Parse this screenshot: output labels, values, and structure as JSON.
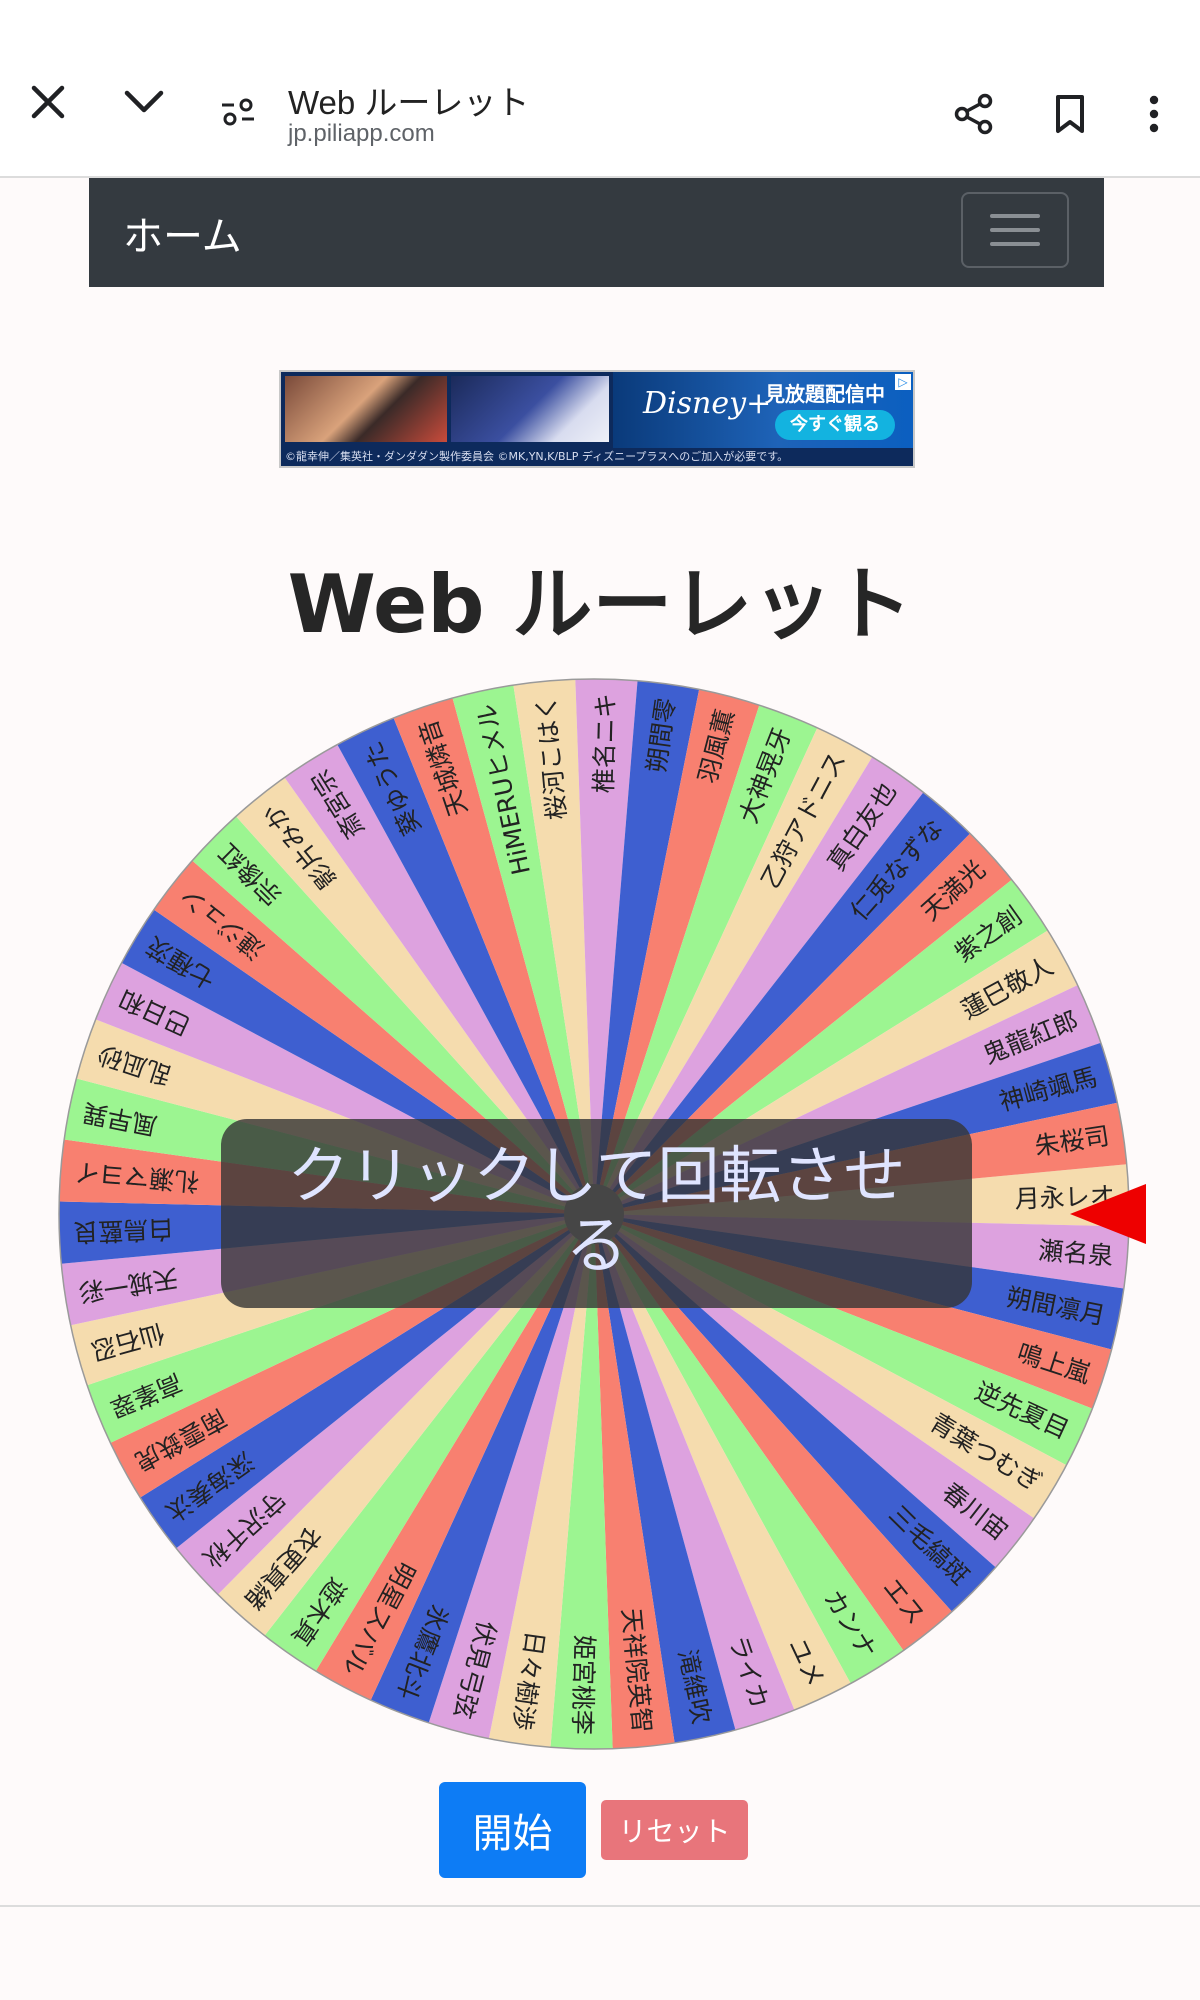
{
  "browser": {
    "title": "Web ルーレット",
    "url": "jp.piliapp.com",
    "icons": [
      "close-icon",
      "chevron-down-icon",
      "page-settings-icon",
      "share-icon",
      "bookmark-icon",
      "more-vert-icon"
    ]
  },
  "navbar": {
    "brand": "ホーム",
    "menu_icon": "hamburger-icon"
  },
  "ad": {
    "brand": "Disney+",
    "headline": "見放題配信中",
    "button": "今すぐ観る",
    "footnote": "©龍幸伸／集英社・ダンダダン製作委員会 ©MK,YN,K/BLP ディズニープラスへのご加入が必要です。"
  },
  "page": {
    "title": "Web ルーレット"
  },
  "wheel": {
    "overlay_text": "クリックして回転させる",
    "segment_colors": [
      "#f5dcae",
      "#dda2df",
      "#3e5fd0",
      "#f88070",
      "#9cf591"
    ],
    "pointer_color": "#ee0000",
    "items": [
      "月永レオ",
      "瀬名泉",
      "朔間凛月",
      "鳴上嵐",
      "逆先夏目",
      "青葉つむぎ",
      "春川宙",
      "三毛縞斑",
      "エス",
      "カンナ",
      "ユメ",
      "ライカ",
      "滝維吹",
      "天祥院英智",
      "姫宮桃李",
      "日々樹渉",
      "伏見弓弦",
      "氷鷹北斗",
      "明星スバル",
      "遊木真",
      "衣更真緒",
      "守沢千秋",
      "深海奏汰",
      "南雲鉄虎",
      "高峯翠",
      "仙石忍",
      "天城一彩",
      "白鳥藍良",
      "礼瀬マヨイ",
      "風早巽",
      "乱凪砂",
      "巴日和",
      "七種茨",
      "漣ジュン",
      "宗像紅",
      "影片みか",
      "斎宮宗",
      "葵ゆうた",
      "天城燐音",
      "HiMERUヒメル",
      "桜河こはく",
      "椎名ニキ",
      "朔間零",
      "羽風薫",
      "大神晃牙",
      "乙狩アドニス",
      "真白友也",
      "仁兎なずな",
      "天満光",
      "紫之創",
      "蓮巳敬人",
      "鬼龍紅郎",
      "神崎颯馬",
      "朱桜司"
    ]
  },
  "buttons": {
    "start": "開始",
    "reset": "リセット"
  }
}
